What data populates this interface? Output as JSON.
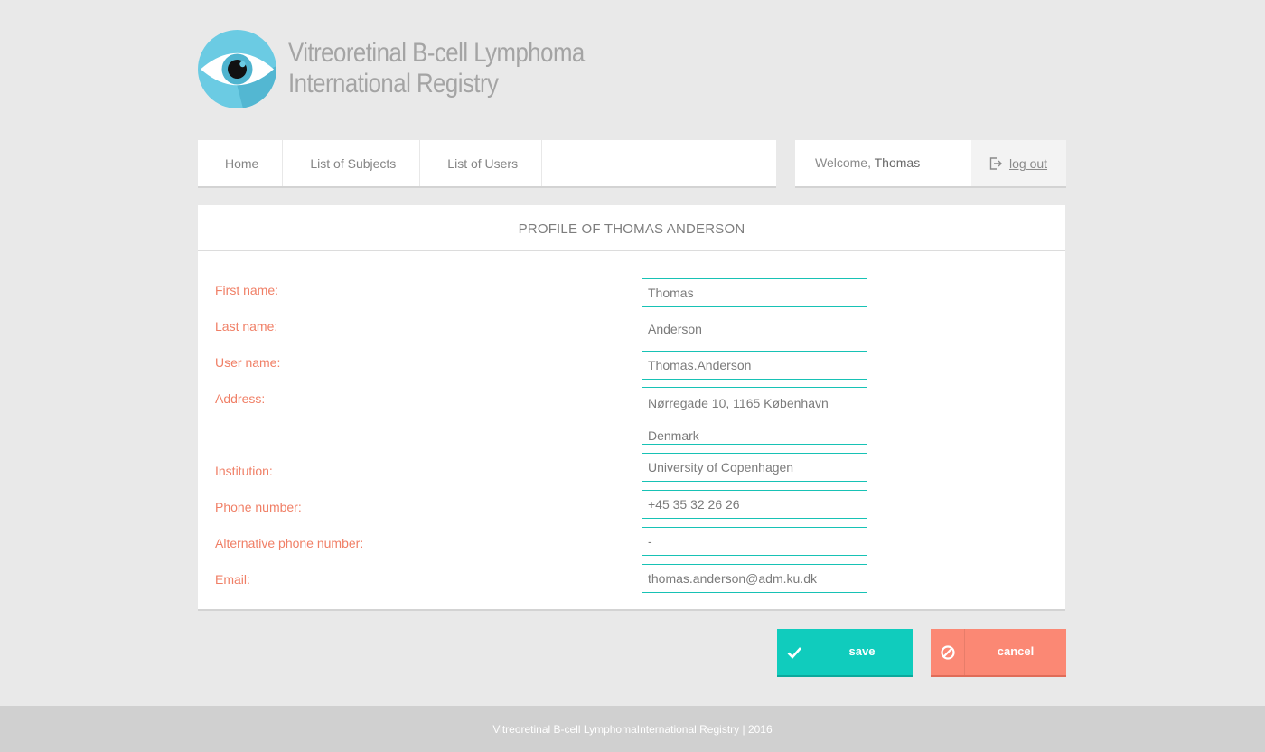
{
  "brand": {
    "line1": "Vitreoretinal B-cell Lymphoma",
    "line2": "International Registry"
  },
  "nav": {
    "items": [
      {
        "label": "Home"
      },
      {
        "label": "List of Subjects"
      },
      {
        "label": "List of Users"
      }
    ]
  },
  "user": {
    "welcome_prefix": "Welcome, ",
    "name": "Thomas",
    "logout_label": "log out"
  },
  "profile": {
    "title": "PROFILE OF THOMAS ANDERSON",
    "fields": {
      "first_name": {
        "label": "First name:",
        "value": "Thomas"
      },
      "last_name": {
        "label": "Last name:",
        "value": "Anderson"
      },
      "user_name": {
        "label": "User name:",
        "value": "Thomas.Anderson"
      },
      "address": {
        "label": "Address:",
        "line1": "Nørregade 10, 1165 København",
        "line2": "Denmark"
      },
      "institution": {
        "label": "Institution:",
        "value": "University of Copenhagen"
      },
      "phone": {
        "label": "Phone number:",
        "value": "+45 35 32 26 26"
      },
      "alt_phone": {
        "label": "Alternative phone number:",
        "value": "-"
      },
      "email": {
        "label": "Email:",
        "value": "thomas.anderson@adm.ku.dk"
      }
    }
  },
  "actions": {
    "save_label": "save",
    "cancel_label": "cancel",
    "save_icon": "checkmark-icon",
    "cancel_icon": "prohibited-icon"
  },
  "footer": {
    "text": "Vitreoretinal B-cell LymphomaInternational Registry | 2016"
  },
  "colors": {
    "accent_teal": "#10ccbd",
    "accent_coral": "#fb8874",
    "label_color": "#f07f66",
    "logo_blue": "#6bcbe3"
  }
}
